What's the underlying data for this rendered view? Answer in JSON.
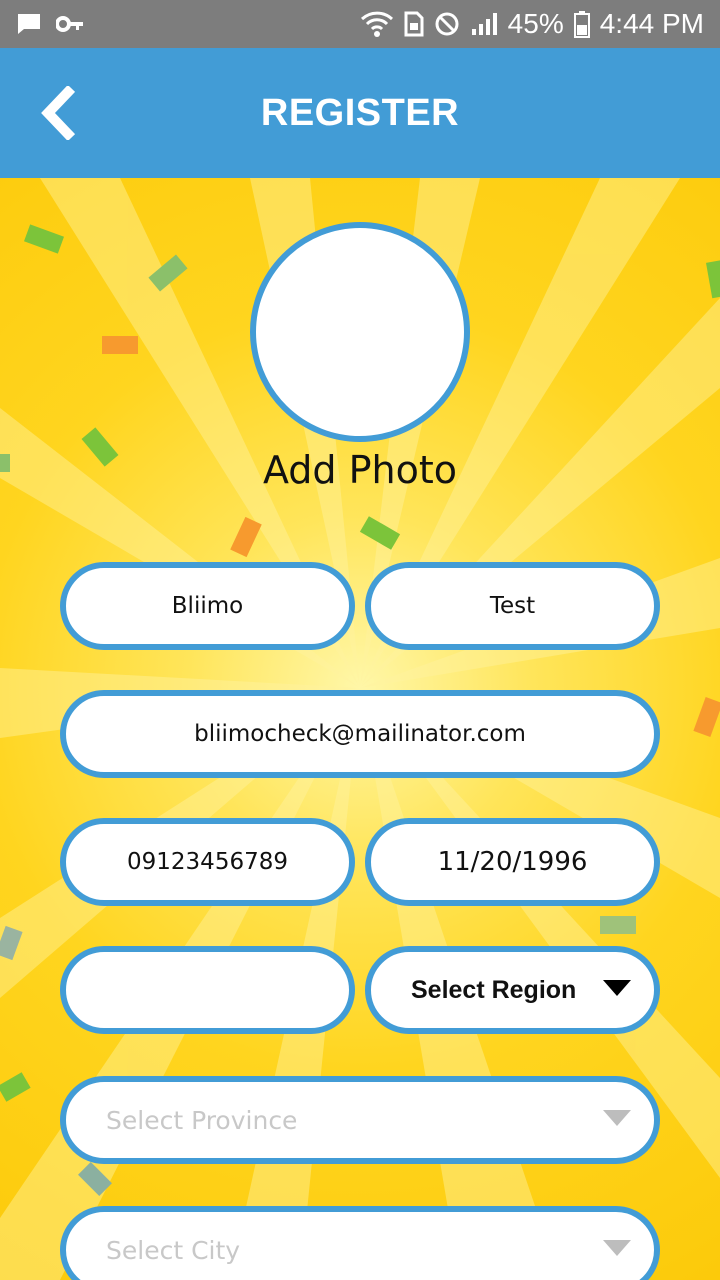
{
  "status_bar": {
    "battery": "45%",
    "time": "4:44 PM",
    "icons": [
      "chat-icon",
      "key-icon",
      "wifi-icon",
      "sim-icon",
      "dnd-icon",
      "signal-icon",
      "battery-icon"
    ]
  },
  "header": {
    "title": "REGISTER",
    "back_icon": "chevron-left-icon"
  },
  "profile": {
    "add_photo_label": "Add Photo"
  },
  "form": {
    "first_name": "Bliimo",
    "last_name": "Test",
    "email": "bliimocheck@mailinator.com",
    "phone": "09123456789",
    "birthdate": "11/20/1996",
    "extra_field": "",
    "region_label": "Select Region",
    "province_placeholder": "Select Province",
    "city_placeholder": "Select City"
  },
  "colors": {
    "accent": "#429cd6",
    "status_bar": "#7d7d7d",
    "background": "#ffd21a"
  }
}
